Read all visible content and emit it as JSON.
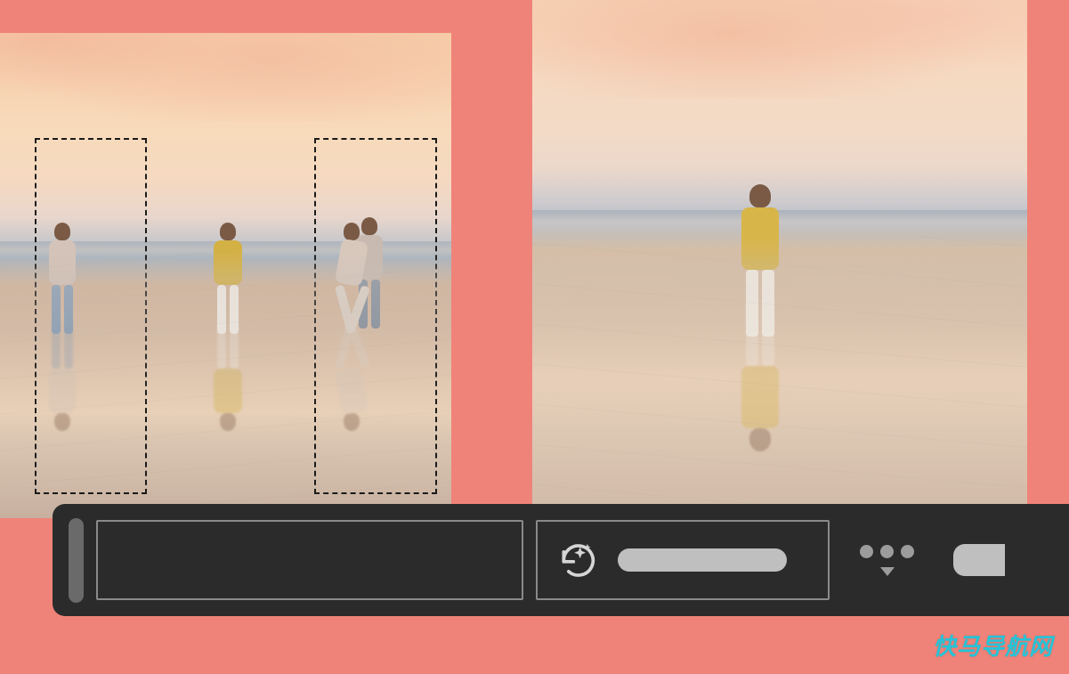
{
  "canvas": {
    "background_color": "#f08379"
  },
  "photos": {
    "left": {
      "description": "beach-sunset-multiple-people",
      "selections": [
        {
          "id": "selection-1",
          "target": "person-left"
        },
        {
          "id": "selection-2",
          "target": "people-right"
        }
      ]
    },
    "right": {
      "description": "beach-sunset-single-person-result"
    }
  },
  "toolbar": {
    "prompt_input": {
      "value": "",
      "placeholder": ""
    },
    "generate_button_label": "",
    "icons": {
      "sparkle": "sparkle-refresh-icon",
      "more": "more-options-icon",
      "dropdown": "chevron-down-icon"
    }
  },
  "watermark": {
    "text": "快马导航网"
  }
}
